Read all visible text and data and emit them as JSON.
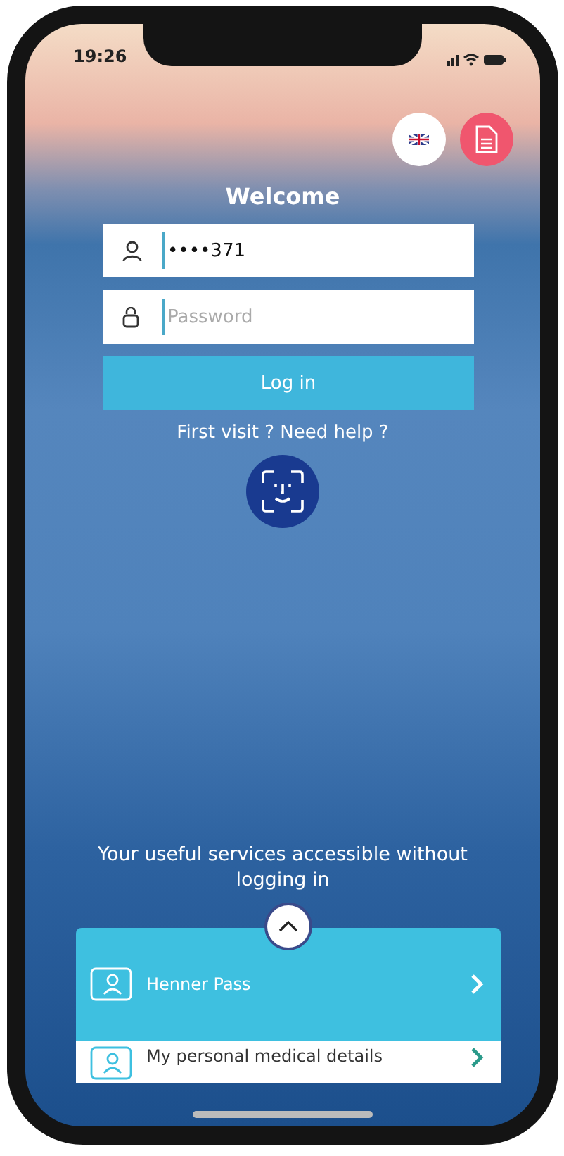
{
  "status_bar": {
    "time": "19:26"
  },
  "header": {
    "title": "Welcome"
  },
  "login_form": {
    "username": {
      "value": "••••371"
    },
    "password": {
      "placeholder": "Password"
    },
    "submit": "Log in",
    "help_link": "First visit ? Need help ?"
  },
  "services": {
    "heading": "Your useful services accessible without logging in",
    "items": [
      {
        "label": "Henner Pass",
        "selected": true
      },
      {
        "label": "My personal medical details",
        "selected": false
      }
    ]
  }
}
